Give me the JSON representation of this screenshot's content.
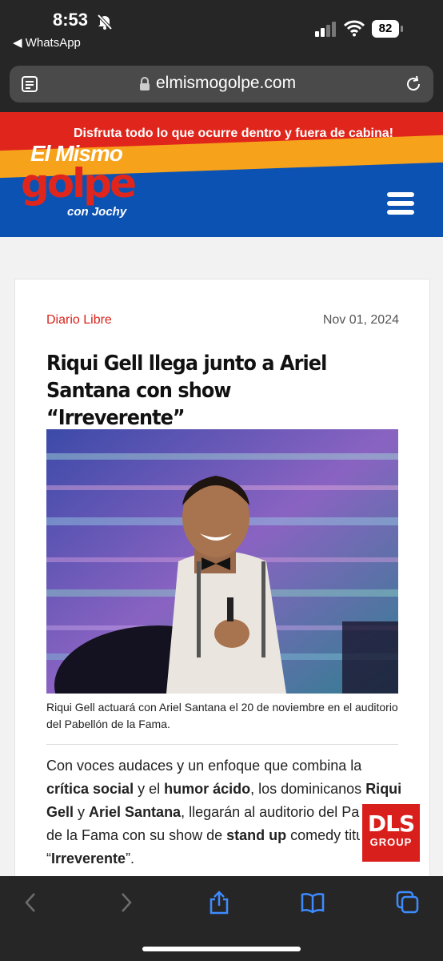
{
  "status_bar": {
    "time": "8:53",
    "back_app": "◀ WhatsApp",
    "battery": "82",
    "icons": [
      "bell-slash-icon",
      "signal-icon",
      "wifi-icon",
      "battery-icon"
    ]
  },
  "browser": {
    "domain": "elmismogolpe.com",
    "icons": [
      "reader-icon",
      "lock-icon",
      "reload-icon"
    ]
  },
  "site": {
    "tagline": "Disfruta todo lo que ocurre dentro y fuera de cabina!",
    "logo_line1": "El Mismo",
    "logo_line2": "golpe",
    "logo_line3": "con Jochy",
    "colors": {
      "red": "#e0261c",
      "orange": "#f7a21b",
      "blue": "#0b52b3"
    }
  },
  "article": {
    "source": "Diario Libre",
    "date": "Nov 01, 2024",
    "headline": "Riqui Gell llega junto a Ariel Santana con show “Irreverente”",
    "caption": "Riqui Gell actuará con Ariel Santana el 20 de noviembre en el auditorio del Pabellón de la Fama.",
    "body": {
      "t1": "Con voces audaces y un enfoque que combina la ",
      "b1": "crítica social",
      "t2": " y el ",
      "b2": "humor ácido",
      "t3": ", los dominicanos ",
      "b3": "Riqui Gell",
      "t4": " y ",
      "b4": "Ariel Santana",
      "t5": ", llegarán al auditorio del Pabellón de la Fama con su show de ",
      "b5": "stand up",
      "t6": " comedy titulado “",
      "b6": "Irreverente",
      "t7": "”."
    }
  },
  "badge": {
    "line1": "DLS",
    "line2": "GROUP"
  },
  "toolbar": {
    "icons": [
      "back-icon",
      "forward-icon",
      "share-icon",
      "bookmarks-icon",
      "tabs-icon"
    ]
  }
}
